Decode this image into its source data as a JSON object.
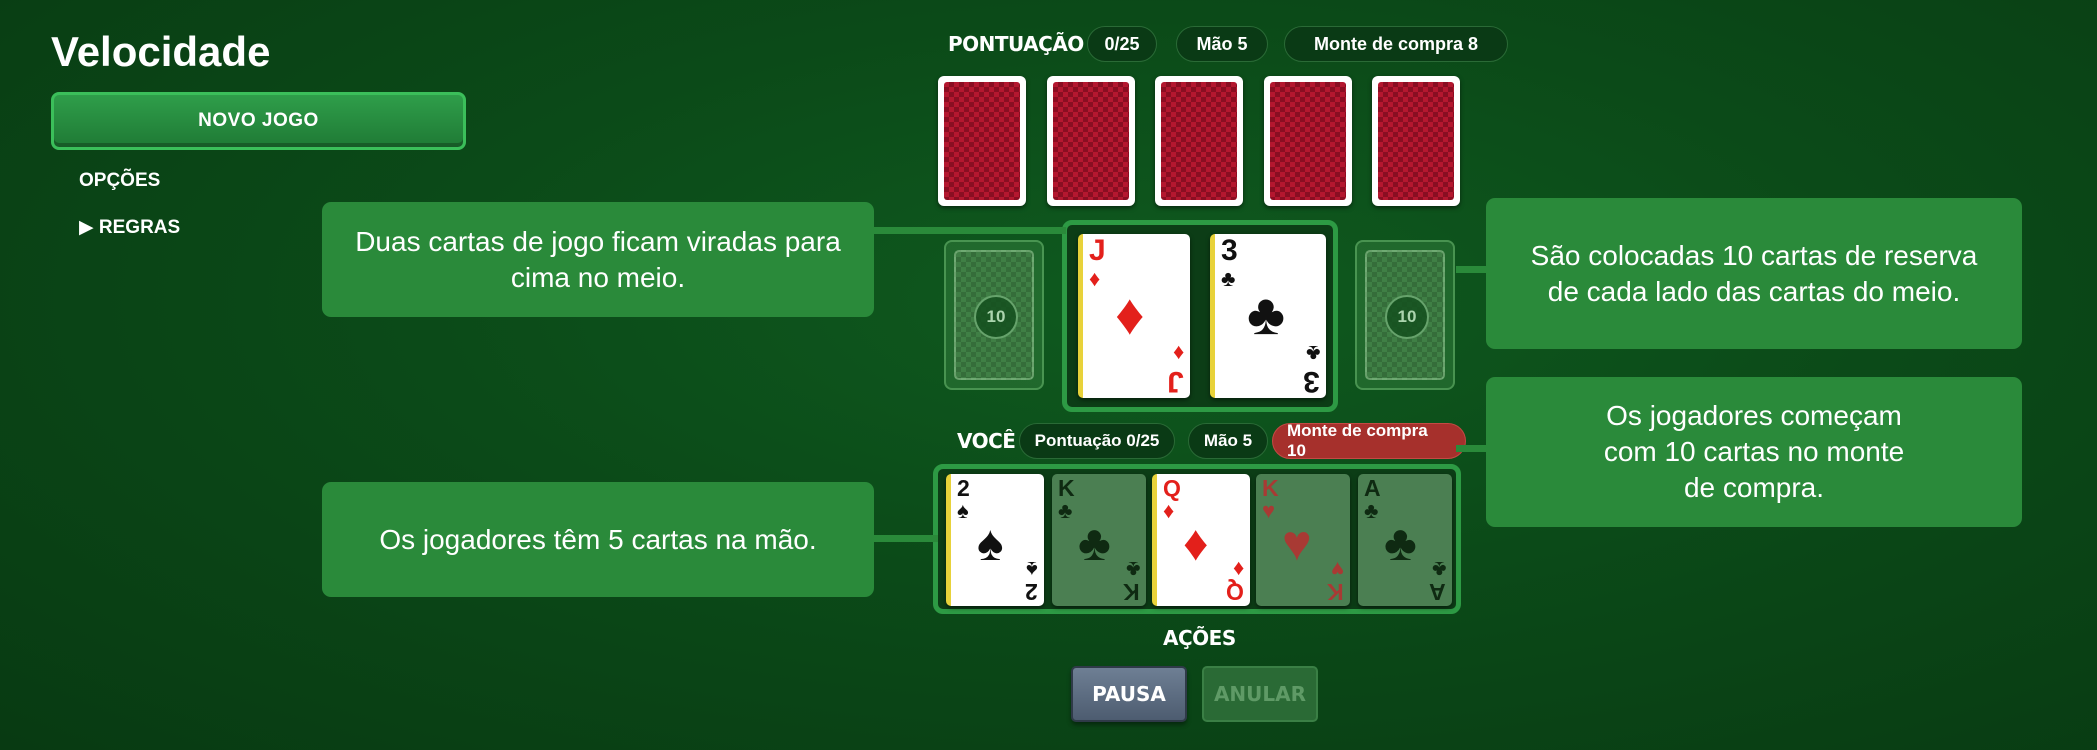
{
  "sidebar": {
    "title": "Velocidade",
    "new_game": "NOVO JOGO",
    "options": "OPÇÕES",
    "rules": "▶ REGRAS"
  },
  "opponent": {
    "label": "PONTUAÇÃO",
    "score": "0/25",
    "hand": "Mão 5",
    "draw_pile": "Monte de compra 8"
  },
  "reserves": {
    "left_count": "10",
    "right_count": "10"
  },
  "center_cards": [
    {
      "rank": "J",
      "suit": "♦",
      "color": "red"
    },
    {
      "rank": "3",
      "suit": "♣",
      "color": "black"
    }
  ],
  "player": {
    "label": "VOCÊ",
    "score": "Pontuação 0/25",
    "hand": "Mão 5",
    "draw_pile": "Monte de compra 10"
  },
  "hand_cards": [
    {
      "rank": "2",
      "suit": "♠",
      "color": "black",
      "playable": true
    },
    {
      "rank": "K",
      "suit": "♣",
      "color": "black",
      "playable": false
    },
    {
      "rank": "Q",
      "suit": "♦",
      "color": "red",
      "playable": true
    },
    {
      "rank": "K",
      "suit": "♥",
      "color": "red",
      "playable": false
    },
    {
      "rank": "A",
      "suit": "♣",
      "color": "black",
      "playable": false
    }
  ],
  "callouts": {
    "center": "Duas cartas de jogo ficam viradas para cima no meio.",
    "reserve": "São colocadas 10 cartas de reserva de cada lado das cartas do meio.",
    "draw": "Os jogadores começam com 10 cartas no monte de compra.",
    "hand": "Os jogadores têm 5 cartas na mão."
  },
  "actions": {
    "label": "AÇÕES",
    "pause": "PAUSA",
    "undo": "ANULAR"
  },
  "colors": {
    "felt": "#0b4a18",
    "accent_green": "#2d9a44",
    "draw_pile_alert": "#a6302c",
    "card_back_red": "#b4172f"
  }
}
